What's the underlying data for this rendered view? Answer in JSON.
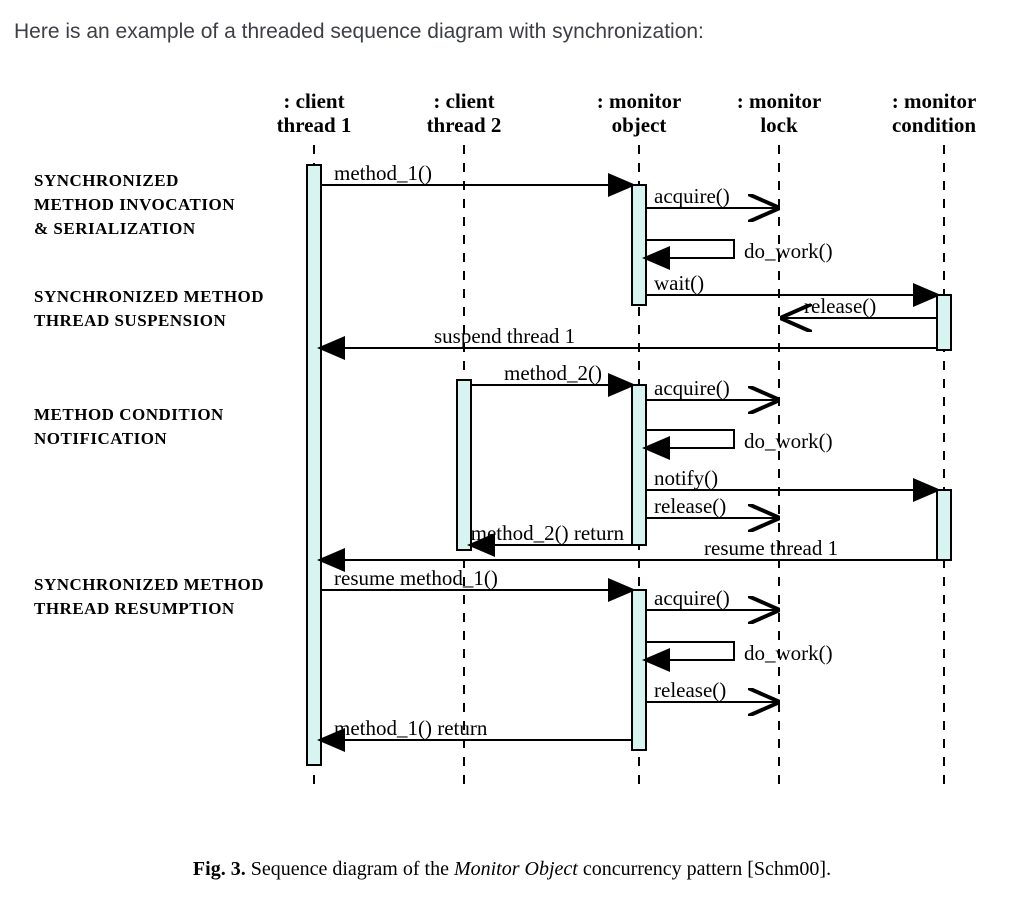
{
  "intro": "Here is an example of a threaded sequence diagram with synchronization:",
  "caption_bold": "Fig. 3.",
  "caption_text": " Sequence diagram of the ",
  "caption_italic": "Monitor Object",
  "caption_tail": " concurrency pattern [Schm00].",
  "lifelines": {
    "ct1a": ": client",
    "ct1b": "thread 1",
    "ct2a": ": client",
    "ct2b": "thread 2",
    "moa": ": monitor",
    "mob": "object",
    "mla": ": monitor",
    "mlb": "lock",
    "mca": ": monitor",
    "mcb": "condition"
  },
  "phases": {
    "p1a": "SYNCHRONIZED",
    "p1b": "METHOD INVOCATION",
    "p1c": "& SERIALIZATION",
    "p2a": "SYNCHRONIZED METHOD",
    "p2b": "THREAD SUSPENSION",
    "p3a": "METHOD CONDITION",
    "p3b": "NOTIFICATION",
    "p4a": "SYNCHRONIZED METHOD",
    "p4b": "THREAD RESUMPTION"
  },
  "msg": {
    "method1": "method_1()",
    "acquire1": "acquire()",
    "dowork1": "do_work()",
    "wait": "wait()",
    "release1": "release()",
    "suspend": "suspend thread 1",
    "method2": "method_2()",
    "acquire2": "acquire()",
    "dowork2": "do_work()",
    "notify": "notify()",
    "release2": "release()",
    "method2return": "method_2() return",
    "resumethread1": "resume thread 1",
    "resumemethod1": "resume method_1()",
    "acquire3": "acquire()",
    "dowork3": "do_work()",
    "release3": "release()",
    "method1return": "method_1() return"
  }
}
